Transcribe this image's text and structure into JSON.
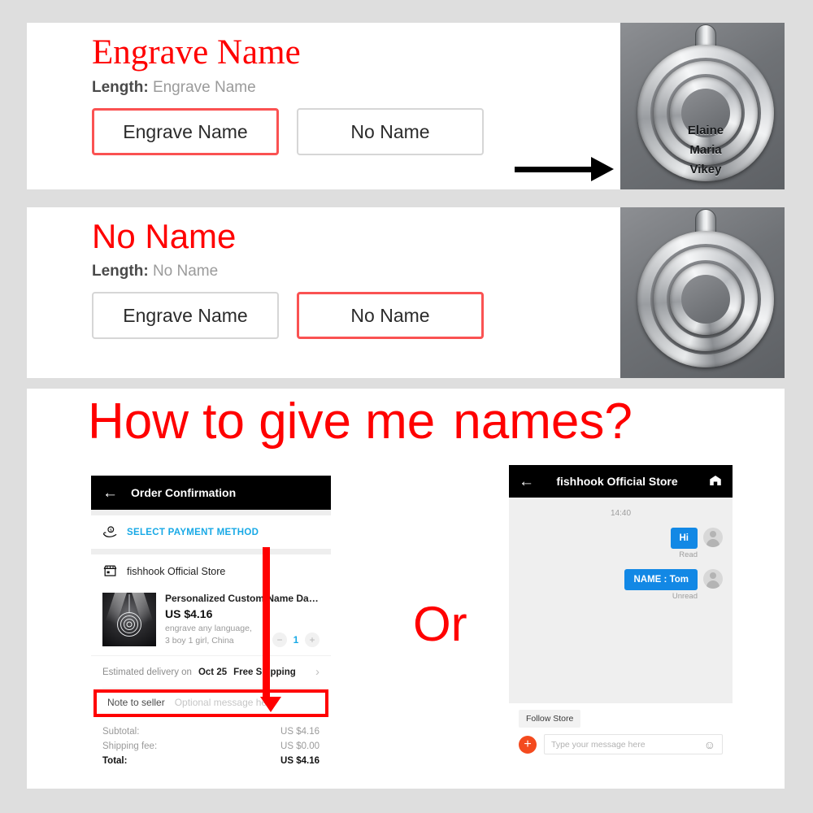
{
  "panels": {
    "engrave": {
      "title": "Engrave Name",
      "length_label": "Length:",
      "length_value": "Engrave Name",
      "option_engrave": "Engrave Name",
      "option_noname": "No Name",
      "arrow": "right-arrow-icon",
      "engraved_names": [
        "Elaine",
        "Maria",
        "Vikey"
      ]
    },
    "noname": {
      "title": "No Name",
      "length_label": "Length:",
      "length_value": "No Name",
      "option_engrave": "Engrave Name",
      "option_noname": "No Name",
      "arrow": "right-arrow-icon",
      "engraved_names": []
    },
    "howto": {
      "title_part1": "How to give me",
      "title_part2": "names?",
      "or_text": "Or"
    }
  },
  "order_screen": {
    "back_icon": "back-arrow-icon",
    "title": "Order Confirmation",
    "payment_icon": "hand-coin-icon",
    "payment_label": "SELECT PAYMENT METHOD",
    "store_icon": "store-icon",
    "store_name": "fishhook Official Store",
    "product": {
      "title": "Personalized Custom Name Date ...",
      "price": "US $4.16",
      "variant_line1": "engrave any language,",
      "variant_line2": "3 boy 1 girl, China",
      "qty_minus": "−",
      "qty_value": "1",
      "qty_plus": "+"
    },
    "delivery": {
      "prefix": "Estimated delivery on",
      "date": "Oct 25",
      "shipping": "Free Shipping",
      "chevron": "chevron-right-icon"
    },
    "note": {
      "label": "Note to seller",
      "placeholder": "Optional message here"
    },
    "totals": [
      {
        "label": "Subtotal:",
        "value": "US $4.16",
        "bold": false
      },
      {
        "label": "Shipping fee:",
        "value": "US $0.00",
        "bold": false
      },
      {
        "label": "Total:",
        "value": "US $4.16",
        "bold": true
      }
    ]
  },
  "chat_screen": {
    "back_icon": "back-arrow-icon",
    "title": "fishhook Official Store",
    "store_icon": "store-icon",
    "timestamp": "14:40",
    "messages": [
      {
        "text": "Hi",
        "status": "Read"
      },
      {
        "text": "NAME : Tom",
        "status": "Unread"
      }
    ],
    "follow_store": "Follow Store",
    "plus_icon": "plus-icon",
    "input_placeholder": "Type your message here",
    "emoji_icon": "smiley-icon"
  },
  "colors": {
    "accent_red": "#ff0000",
    "selected_border": "#fa5252",
    "link_blue": "#18a9e6",
    "bubble_blue": "#1288e5",
    "plus_orange": "#f44a1e",
    "page_bg": "#dedede"
  }
}
